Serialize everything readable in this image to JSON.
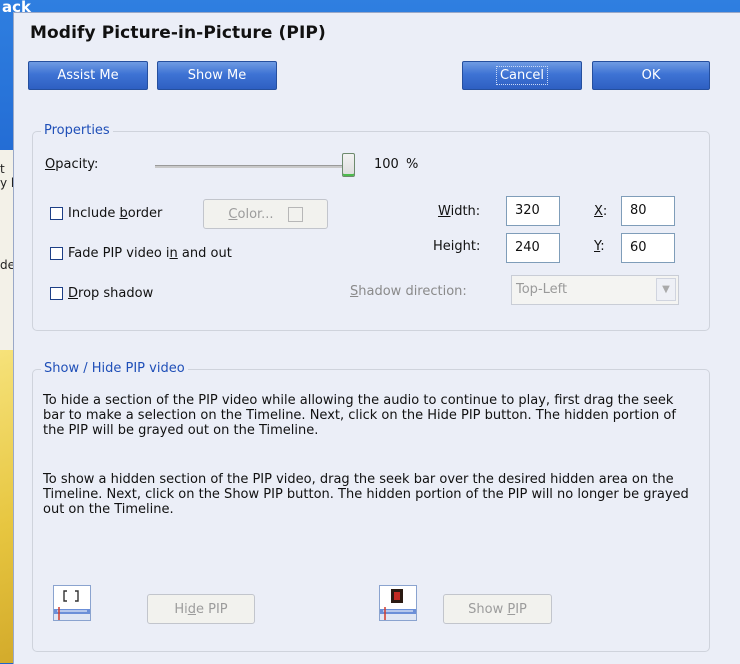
{
  "background": {
    "title_fragment": "ack",
    "side_text": [
      "t",
      "y b",
      "de"
    ]
  },
  "dialog": {
    "title": "Modify Picture-in-Picture (PIP)",
    "buttons": {
      "assist": "Assist Me",
      "show": "Show Me",
      "cancel": "Cancel",
      "ok": "OK"
    }
  },
  "properties": {
    "legend": "Properties",
    "opacity_label": "Opacity:",
    "opacity_value": "100",
    "opacity_unit": "%",
    "opacity_level": 100,
    "include_border": {
      "label": "Include border",
      "checked": false
    },
    "color_button": "Color...",
    "fade": {
      "label": "Fade PIP video in and out",
      "checked": false
    },
    "drop_shadow": {
      "label": "Drop shadow",
      "checked": false
    },
    "width_label": "Width:",
    "width_value": "320",
    "height_label": "Height:",
    "height_value": "240",
    "x_label": "X:",
    "x_value": "80",
    "y_label": "Y:",
    "y_value": "60",
    "shadow_dir_label": "Shadow direction:",
    "shadow_dir_value": "Top-Left"
  },
  "showhide": {
    "legend": "Show / Hide PIP video",
    "para1": "To hide a section of the PIP video while allowing the audio to continue to play, first drag the seek bar to make a selection on the Timeline. Next, click on the Hide PIP button. The hidden portion of the PIP will be grayed out on the Timeline.",
    "para2": "To show a hidden section of the PIP video, drag the seek bar over the desired hidden area on the Timeline. Next, click on the Show PIP button. The hidden portion of the PIP will no longer be grayed out on the Timeline.",
    "hide_button": "Hide PIP",
    "show_button": "Show PIP"
  },
  "colors": {
    "accent": "#2e5fc2",
    "legend": "#1f4fb8",
    "dialog_bg": "#ebeef7"
  }
}
